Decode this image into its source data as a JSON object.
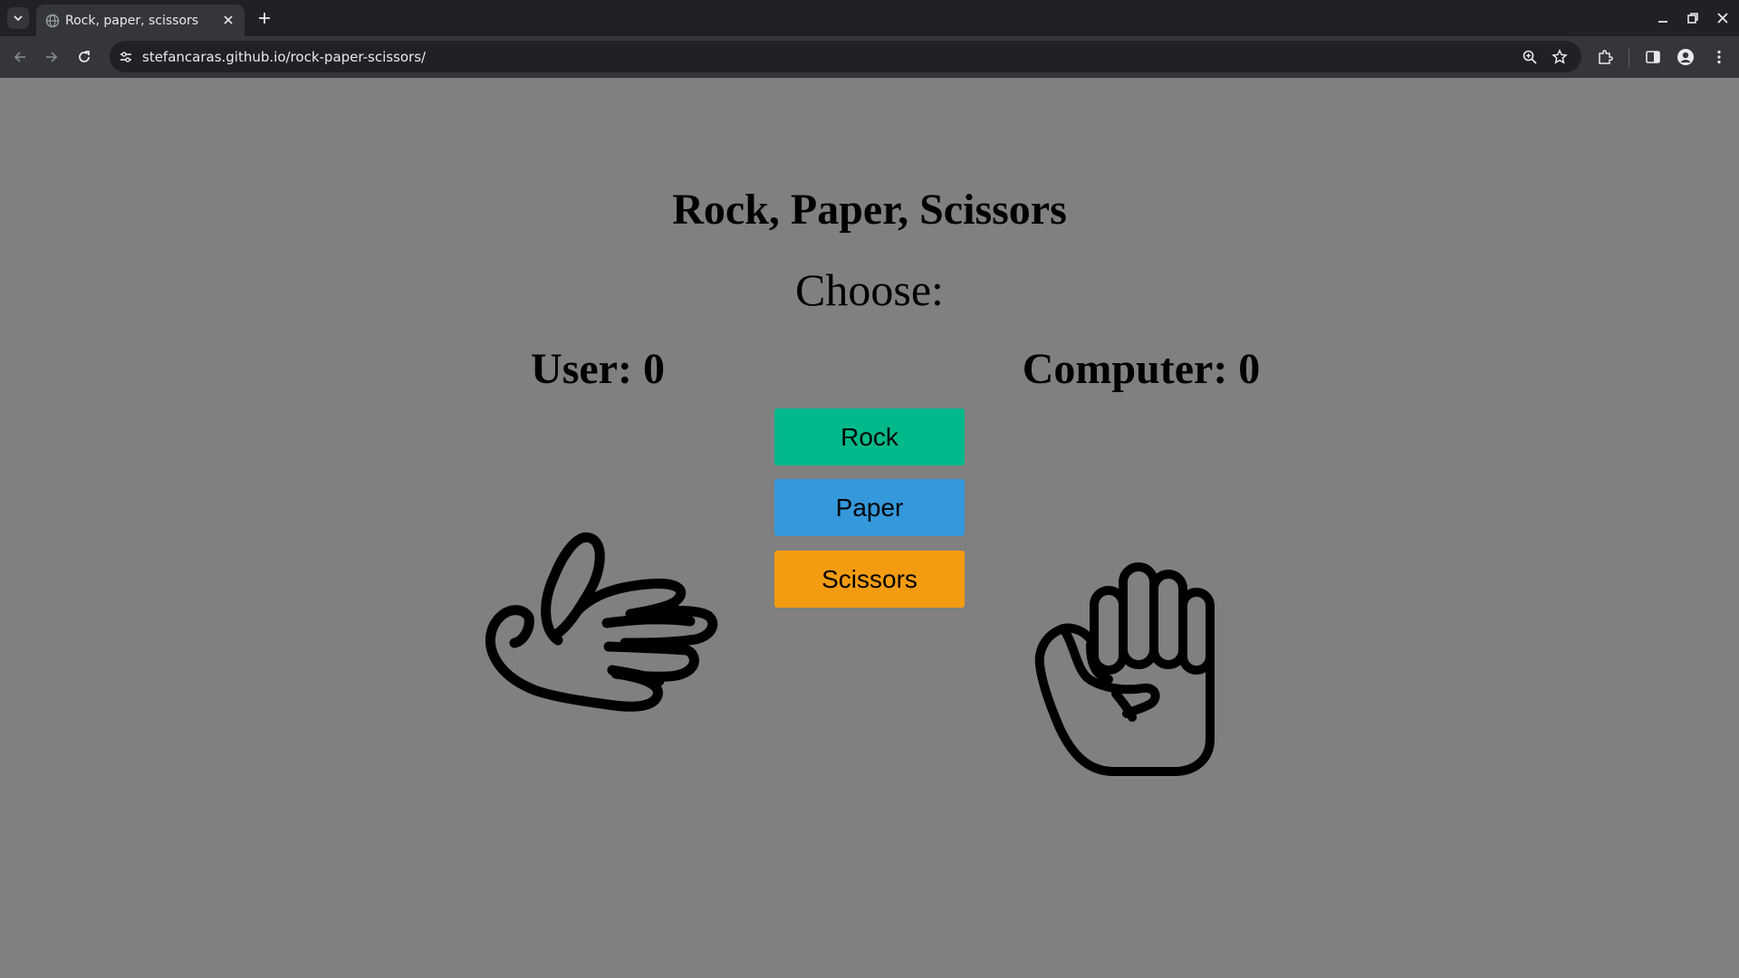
{
  "browser": {
    "tab_title": "Rock, paper, scissors",
    "url": "stefancaras.github.io/rock-paper-scissors/"
  },
  "game": {
    "title": "Rock, Paper, Scissors",
    "prompt": "Choose:",
    "user_score_label": "User: 0",
    "computer_score_label": "Computer: 0",
    "user_score": 0,
    "computer_score": 0,
    "buttons": {
      "rock": "Rock",
      "paper": "Paper",
      "scissors": "Scissors"
    },
    "button_colors": {
      "rock": "#00b98b",
      "paper": "#3498db",
      "scissors": "#f39c12"
    },
    "user_choice_icon": "paper-hand-icon",
    "computer_choice_icon": "rock-fist-icon"
  },
  "colors": {
    "page_background": "#808080",
    "chrome_dark": "#202124",
    "chrome_toolbar": "#35363a"
  }
}
